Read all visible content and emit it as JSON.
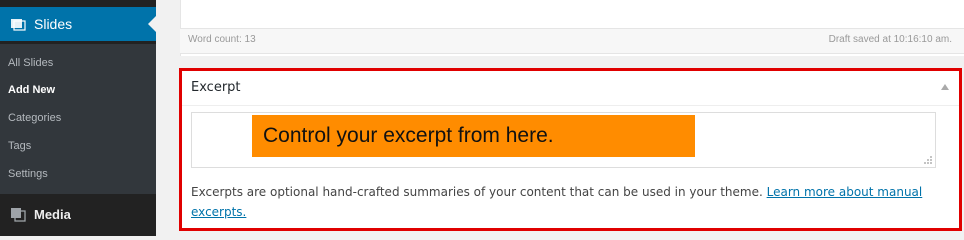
{
  "sidebar": {
    "current_item": "Slides",
    "submenu": [
      "All Slides",
      "Add New",
      "Categories",
      "Tags",
      "Settings"
    ],
    "bottom_item": "Media"
  },
  "editor_status": {
    "word_count": "Word count: 13",
    "draft_saved": "Draft saved at 10:16:10 am."
  },
  "excerpt_box": {
    "title": "Excerpt",
    "callout_text": "Control your excerpt from here.",
    "help_text": "Excerpts are optional hand-crafted summaries of your content that can be used in your theme. ",
    "help_link": "Learn more about manual excerpts."
  },
  "colors": {
    "sidebar_bg": "#222222",
    "accent": "#0073aa",
    "highlight_border": "#e00000",
    "callout_bg": "#ff8c00"
  }
}
